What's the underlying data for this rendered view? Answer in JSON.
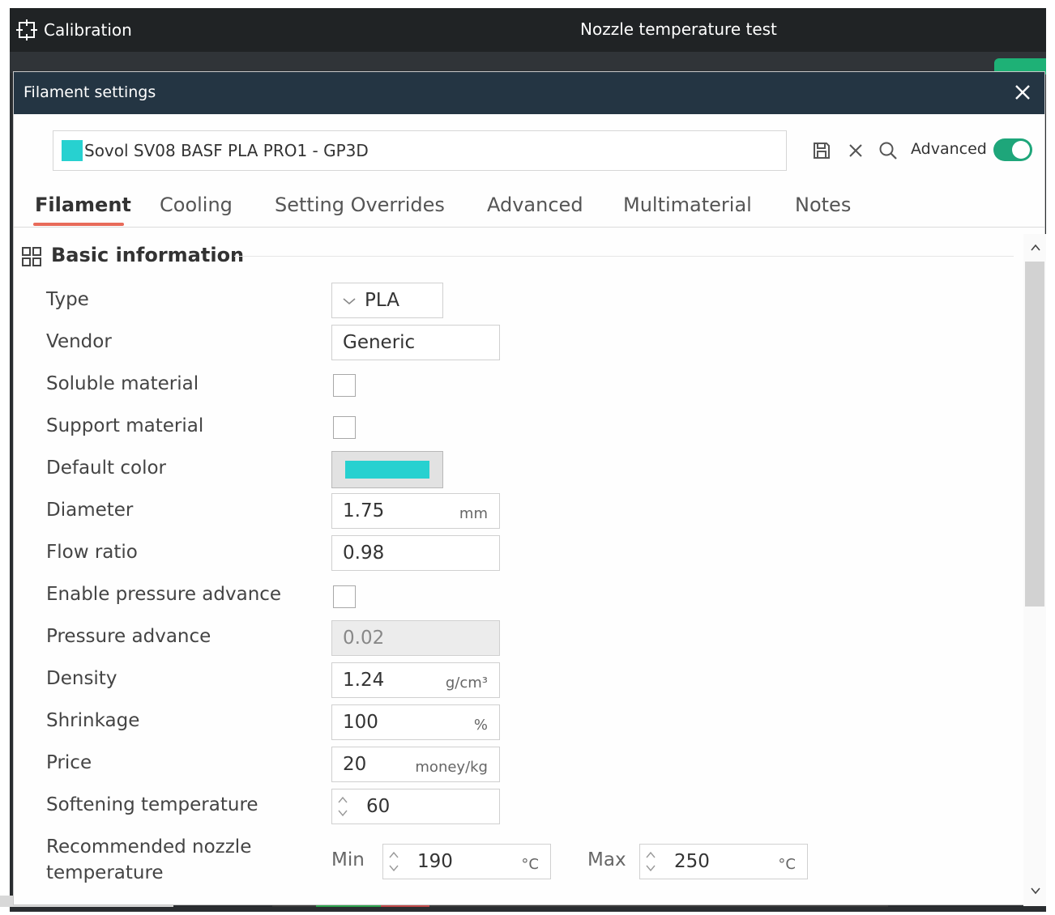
{
  "app": {
    "title": "Calibration",
    "window_title": "Nozzle temperature test"
  },
  "dialog": {
    "title": "Filament settings",
    "preset": {
      "name": "Sovol SV08 BASF PLA PRO1 - GP3D",
      "color": "#27d1d0"
    },
    "advanced_label": "Advanced",
    "advanced_enabled": true,
    "tabs": [
      {
        "label": "Filament",
        "active": true
      },
      {
        "label": "Cooling"
      },
      {
        "label": "Setting Overrides"
      },
      {
        "label": "Advanced"
      },
      {
        "label": "Multimaterial"
      },
      {
        "label": "Notes"
      }
    ],
    "section_title": "Basic information",
    "fields": {
      "type": {
        "label": "Type",
        "value": "PLA"
      },
      "vendor": {
        "label": "Vendor",
        "value": "Generic"
      },
      "soluble": {
        "label": "Soluble material",
        "checked": false
      },
      "support": {
        "label": "Support material",
        "checked": false
      },
      "default_color": {
        "label": "Default color",
        "value": "#27d1d0"
      },
      "diameter": {
        "label": "Diameter",
        "value": "1.75",
        "unit": "mm"
      },
      "flow_ratio": {
        "label": "Flow ratio",
        "value": "0.98"
      },
      "enable_pa": {
        "label": "Enable pressure advance",
        "checked": false
      },
      "pressure_advance": {
        "label": "Pressure advance",
        "value": "0.02"
      },
      "density": {
        "label": "Density",
        "value": "1.24",
        "unit": "g/cm³"
      },
      "shrinkage": {
        "label": "Shrinkage",
        "value": "100",
        "unit": "%"
      },
      "price": {
        "label": "Price",
        "value": "20",
        "unit": "money/kg"
      },
      "softening": {
        "label": "Softening temperature",
        "value": "60"
      },
      "nozzle_temp": {
        "label_line1": "Recommended nozzle",
        "label_line2": "temperature",
        "min_label": "Min",
        "min_value": "190",
        "max_label": "Max",
        "max_value": "250",
        "unit": "°C"
      }
    }
  },
  "colors": {
    "header_bg": "#243543",
    "accent_teal": "#1ea67a",
    "tab_underline": "#e86b5a"
  }
}
